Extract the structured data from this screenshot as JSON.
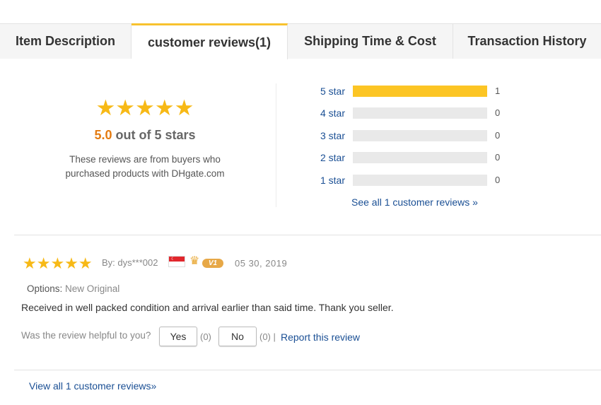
{
  "tabs": [
    {
      "label": "Item Description"
    },
    {
      "label": "customer reviews(1)"
    },
    {
      "label": "Shipping Time & Cost"
    },
    {
      "label": "Transaction History"
    }
  ],
  "summary": {
    "stars": "★★★★★",
    "rating": "5.0",
    "out_of": " out of 5 stars",
    "note_line1": "These reviews are from buyers who",
    "note_line2": "purchased products with DHgate.com"
  },
  "histogram": [
    {
      "label": "5 star",
      "count": "1",
      "fraction": 1.0
    },
    {
      "label": "4 star",
      "count": "0",
      "fraction": 0
    },
    {
      "label": "3 star",
      "count": "0",
      "fraction": 0
    },
    {
      "label": "2 star",
      "count": "0",
      "fraction": 0
    },
    {
      "label": "1 star",
      "count": "0",
      "fraction": 0
    }
  ],
  "see_all": "See all 1 customer reviews »",
  "review": {
    "stars": "★★★★★",
    "by": "By: dys***002",
    "vip": "V1",
    "date": "05 30, 2019",
    "options_label": "Options:",
    "options_value": " New Original",
    "text": "Received in well packed condition and arrival earlier than said time. Thank you seller.",
    "helpful_question": "Was the review helpful to you?",
    "yes_label": "Yes",
    "yes_count": "(0)",
    "no_label": "No",
    "no_count": "(0) |",
    "report_label": "Report this review"
  },
  "view_all": "View all 1 customer reviews»",
  "colors": {
    "star": "#f7b916",
    "bar_fill": "#fcc524",
    "link": "#1a4f94",
    "rating": "#e47b10"
  }
}
